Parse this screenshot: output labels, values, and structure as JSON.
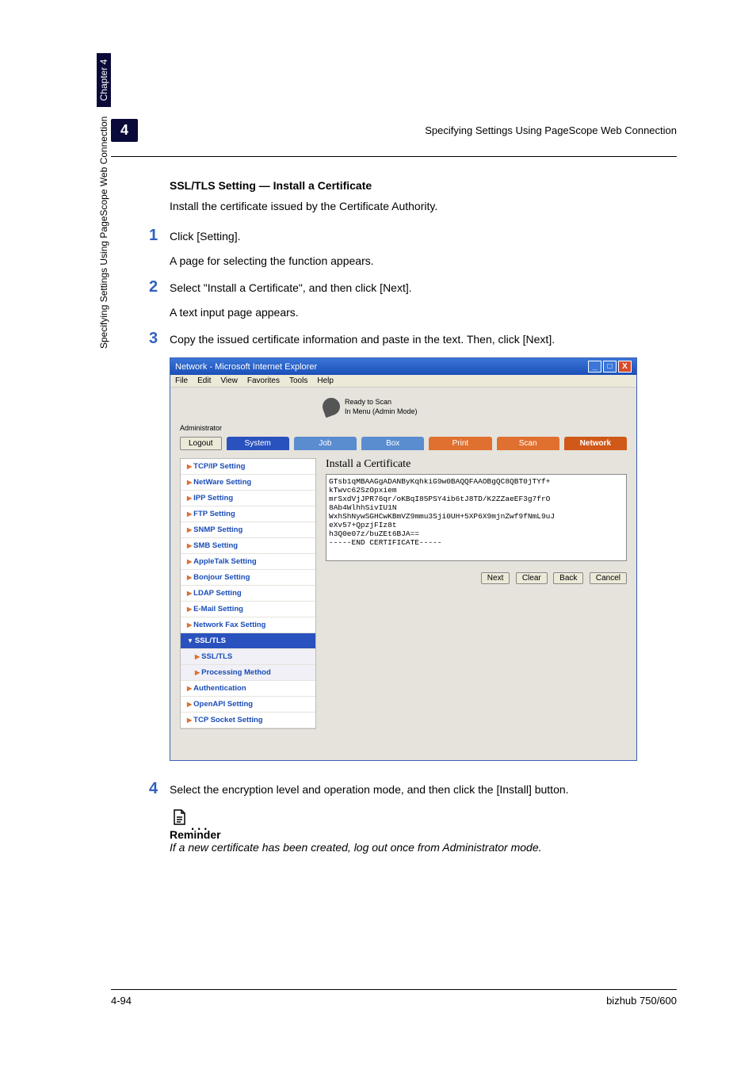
{
  "header": {
    "chapter_num": "4",
    "chapter_title": "Specifying Settings Using PageScope Web Connection"
  },
  "section": {
    "title": "SSL/TLS Setting — Install a Certificate",
    "intro": "Install the certificate issued by the Certificate Authority."
  },
  "steps": {
    "s1_num": "1",
    "s1_text": "Click [Setting].",
    "s1_sub": "A page for selecting the function appears.",
    "s2_num": "2",
    "s2_text": "Select \"Install a Certificate\", and then click [Next].",
    "s2_sub": "A text input page appears.",
    "s3_num": "3",
    "s3_text": "Copy the issued certificate information and paste in the text. Then, click [Next].",
    "s4_num": "4",
    "s4_text": "Select the encryption level and operation mode, and then click the [Install] button."
  },
  "browser": {
    "title": "Network - Microsoft Internet Explorer",
    "menu": {
      "file": "File",
      "edit": "Edit",
      "view": "View",
      "favorites": "Favorites",
      "tools": "Tools",
      "help": "Help"
    },
    "logo": {
      "line1": "Ready to Scan",
      "line2": "In Menu (Admin Mode)"
    },
    "admin": "Administrator",
    "logout": "Logout",
    "tabs": {
      "system": "System",
      "job": "Job",
      "box": "Box",
      "print": "Print",
      "scan": "Scan",
      "network": "Network"
    },
    "sidebar": {
      "tcpip": "TCP/IP Setting",
      "netware": "NetWare Setting",
      "ipp": "IPP Setting",
      "ftp": "FTP Setting",
      "snmp": "SNMP Setting",
      "smb": "SMB Setting",
      "appletalk": "AppleTalk Setting",
      "bonjour": "Bonjour Setting",
      "ldap": "LDAP Setting",
      "email": "E-Mail Setting",
      "netfax": "Network Fax Setting",
      "ssltls_group": "SSL/TLS",
      "ssltls": "SSL/TLS",
      "processing": "Processing Method",
      "auth": "Authentication",
      "openapi": "OpenAPI Setting",
      "tcpsocket": "TCP Socket Setting"
    },
    "panel": {
      "title": "Install a Certificate",
      "cert": "GTsb1qMBAAGgADANByKqhkiG9w0BAQQFAAOBgQC8QBT0jTYf+\nkTwvc62SzOpxiem\nmrSxdVjJPR76qr/oKBqI85PSY4ib6tJ8TD/K2ZZaeEF3g7frO\n8Ab4WlhhSivIU1N\nWxhShNywSGHCwKBmVZ9mmu3Sji0UH+5XP6X9mjnZwf9fNmL9uJ\neXv57+QpzjFIz8t\nh3Q0e07z/buZEt6BJA==\n-----END CERTIFICATE-----",
      "btn_next": "Next",
      "btn_clear": "Clear",
      "btn_back": "Back",
      "btn_cancel": "Cancel"
    }
  },
  "reminder": {
    "title": "Reminder",
    "text": "If a new certificate has been created, log out once from Administrator mode."
  },
  "side_label": {
    "text": "Specifying Settings Using PageScope Web Connection",
    "chapter": "Chapter 4"
  },
  "footer": {
    "left": "4-94",
    "right": "bizhub 750/600"
  }
}
